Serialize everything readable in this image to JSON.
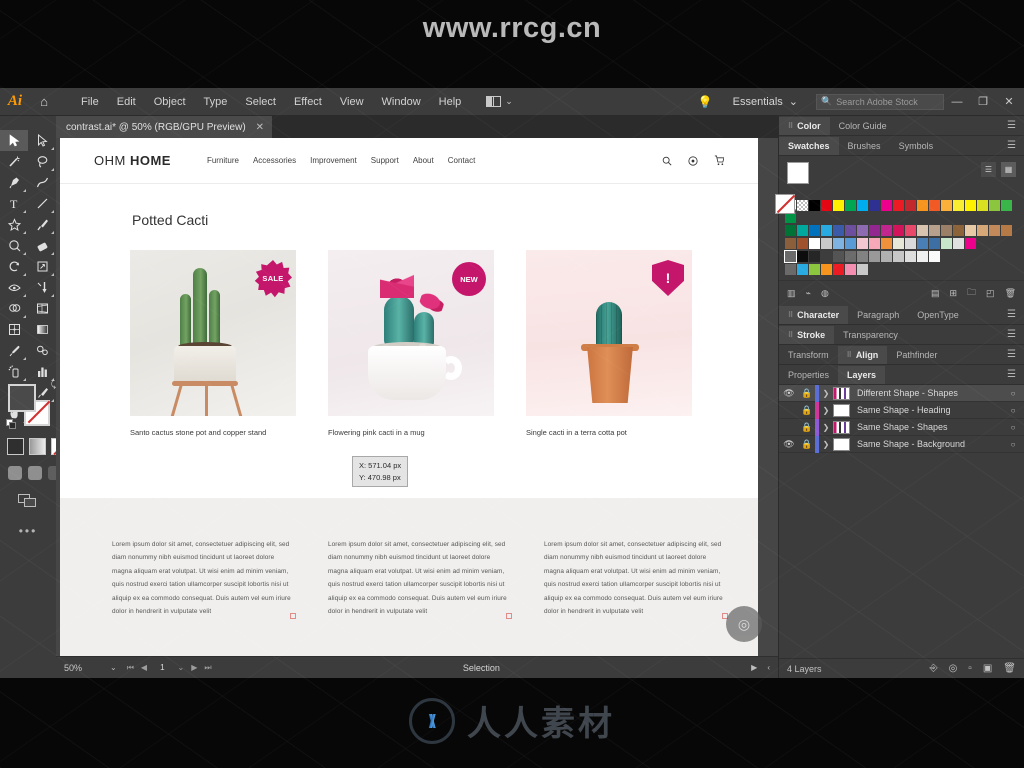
{
  "watermark": {
    "top": "www.rrcg.cn",
    "bottom": "人人素材",
    "logo_icon": "rrcg-logo-icon"
  },
  "app": {
    "logo": "Ai",
    "home_icon": "home-icon",
    "menu": [
      "File",
      "Edit",
      "Object",
      "Type",
      "Select",
      "Effect",
      "View",
      "Window",
      "Help"
    ],
    "arrange_icon": "arrange-documents-icon",
    "arrange_caret": "⌄",
    "bulb_icon": "lightbulb-icon",
    "workspace": "Essentials",
    "workspace_caret": "⌄",
    "search_icon": "search-icon",
    "search_placeholder": "Search Adobe Stock",
    "search_value": "",
    "window_buttons": {
      "minimize": "—",
      "restore": "❐",
      "close": "✕"
    },
    "collapse_icon": "«",
    "document_tab": {
      "title": "contrast.ai* @ 50% (RGB/GPU Preview)",
      "close": "✕"
    }
  },
  "toolbar": {
    "tools": [
      {
        "name": "selection-tool",
        "icon": "arrow-solid",
        "selected": true
      },
      {
        "name": "direct-selection-tool",
        "icon": "arrow-outline",
        "selected": false
      },
      {
        "name": "magic-wand-tool",
        "icon": "wand",
        "selected": false
      },
      {
        "name": "lasso-tool",
        "icon": "lasso",
        "selected": false
      },
      {
        "name": "pen-tool",
        "icon": "pen",
        "selected": false
      },
      {
        "name": "curvature-tool",
        "icon": "curvature",
        "selected": false
      },
      {
        "name": "type-tool",
        "icon": "T",
        "selected": false
      },
      {
        "name": "line-segment-tool",
        "icon": "line",
        "selected": false
      },
      {
        "name": "shape-tool",
        "icon": "star",
        "selected": false
      },
      {
        "name": "paintbrush-tool",
        "icon": "brush",
        "selected": false
      },
      {
        "name": "shaper-tool",
        "icon": "shaper",
        "selected": false
      },
      {
        "name": "eraser-tool",
        "icon": "eraser",
        "selected": false
      },
      {
        "name": "rotate-tool",
        "icon": "rotate",
        "selected": false
      },
      {
        "name": "scale-tool",
        "icon": "scale",
        "selected": false
      },
      {
        "name": "width-tool",
        "icon": "width",
        "selected": false
      },
      {
        "name": "free-transform-tool",
        "icon": "transform",
        "selected": false
      },
      {
        "name": "shape-builder-tool",
        "icon": "shape-builder",
        "selected": false
      },
      {
        "name": "perspective-grid-tool",
        "icon": "perspective",
        "selected": false
      },
      {
        "name": "mesh-tool",
        "icon": "mesh",
        "selected": false
      },
      {
        "name": "gradient-tool",
        "icon": "gradient",
        "selected": false
      },
      {
        "name": "eyedropper-tool",
        "icon": "eyedropper",
        "selected": false
      },
      {
        "name": "blend-tool",
        "icon": "blend",
        "selected": false
      },
      {
        "name": "symbol-sprayer-tool",
        "icon": "symbol-sprayer",
        "selected": false
      },
      {
        "name": "column-graph-tool",
        "icon": "bar-chart",
        "selected": false
      },
      {
        "name": "artboard-tool",
        "icon": "artboard",
        "selected": false
      },
      {
        "name": "slice-tool",
        "icon": "slice",
        "selected": false
      },
      {
        "name": "hand-tool",
        "icon": "hand",
        "selected": false
      },
      {
        "name": "zoom-tool",
        "icon": "magnifier",
        "selected": false
      }
    ],
    "fill_stroke": {
      "fill_icon": "fill-swatch",
      "stroke_icon": "stroke-swatch-none",
      "swap_icon": "swap-fill-stroke-icon",
      "default_icon": "default-fill-stroke-icon"
    },
    "color_modes": [
      "color-mode-icon",
      "gradient-mode-icon",
      "none-mode-icon"
    ],
    "draw_modes": [
      "draw-normal-icon",
      "draw-behind-icon",
      "draw-inside-icon"
    ],
    "screen_mode_icon": "change-screen-mode-icon",
    "more_icon": "edit-toolbar-icon"
  },
  "document": {
    "site": {
      "brand_light": "OHM ",
      "brand_bold": "HOME",
      "nav": [
        "Furniture",
        "Accessories",
        "Improvement",
        "Support",
        "About",
        "Contact"
      ],
      "icons": [
        "search-icon",
        "account-icon",
        "cart-icon"
      ],
      "section_title": "Potted Cacti",
      "cards": [
        {
          "caption": "Santo cactus stone pot and copper stand",
          "badge": "SALE",
          "badge_shape": "starburst"
        },
        {
          "caption": "Flowering pink cacti in a mug",
          "badge": "NEW",
          "badge_shape": "circle"
        },
        {
          "caption": "Single cacti in a terra cotta pot",
          "badge": "!",
          "badge_shape": "shield"
        }
      ],
      "lorem": "Lorem ipsum dolor sit amet, consectetuer adipiscing elit, sed diam nonummy nibh euismod tincidunt ut laoreet dolore magna aliquam erat volutpat. Ut wisi enim ad minim veniam, quis nostrud exerci tation ullamcorper suscipit lobortis nisi ut aliquip ex ea commodo consequat. Duis autem vel eum iriure dolor in hendrerit in vulputate velit",
      "lorem_columns": 3
    },
    "cursor_tooltip": {
      "x": "X: 571.04 px",
      "y": "Y: 470.98 px"
    }
  },
  "panels": {
    "group_color": {
      "tabs": [
        {
          "label": "Color",
          "active": true,
          "grip": true
        },
        {
          "label": "Color Guide",
          "active": false,
          "grip": false
        }
      ],
      "menu_icon": "panel-menu-icon"
    },
    "group_swatches": {
      "tabs": [
        {
          "label": "Swatches",
          "active": true,
          "grip": false
        },
        {
          "label": "Brushes",
          "active": false,
          "grip": false
        },
        {
          "label": "Symbols",
          "active": false,
          "grip": false
        }
      ],
      "menu_icon": "panel-menu-icon",
      "fill_icon": "swatch-fill-icon",
      "stroke_icon": "swatch-stroke-none-icon",
      "view_buttons": [
        "list-view-icon",
        "grid-view-icon"
      ],
      "active_view": "grid-view-icon",
      "footer_icons": [
        "swatch-libraries-icon",
        "show-swatch-kinds-icon",
        "color-group-icon",
        "swatch-options-icon",
        "new-color-group-icon",
        "new-swatch-icon",
        "delete-swatch-icon"
      ],
      "colors_row1": [
        "#ffffff",
        "#ffffff",
        "#000000",
        "#e30613",
        "#fff200",
        "#00a651",
        "#00aeef",
        "#2e3192",
        "#ec008c",
        "#ed1c24",
        "#c1272d",
        "#f7941e",
        "#f15a24",
        "#fbb03b",
        "#f9ed32",
        "#fff200",
        "#d9e021",
        "#8cc63f",
        "#39b54a",
        "#009245"
      ],
      "colors_row2": [
        "#007236",
        "#00a99d",
        "#0071bc",
        "#29abe2",
        "#3b5ba9",
        "#6b4e9e",
        "#8e6bb0",
        "#92278f",
        "#c1268f",
        "#d4145a",
        "#e8496a",
        "#d9c4b0",
        "#b8a18c",
        "#9c7f67",
        "#8c6239",
        "#e8c9a6",
        "#d6a878",
        "#c2895a",
        "#b57a45"
      ],
      "colors_row3": [
        "#8b5e3c",
        "#a0522d",
        "#ffffff",
        "#c9c9c9",
        "#7fb3e0",
        "#5a9bd5",
        "#f4c7d0",
        "#f7a8b8",
        "#f0913c",
        "#e8e8d8",
        "#dadada",
        "#4a7fb5",
        "#3d6fa5",
        "#c8e6c9",
        "#e0e0e0",
        "#ec008c"
      ],
      "colors_row4": [
        "#6a6a6a",
        "#0d0d0d",
        "#262626",
        "#3d3d3d",
        "#545454",
        "#6b6b6b",
        "#828282",
        "#999999",
        "#b0b0b0",
        "#c7c7c7",
        "#dedede",
        "#f0f0f0",
        "#fafafa"
      ],
      "colors_row5": [
        "#6a6a6a",
        "#29abe2",
        "#8cc63f",
        "#f7941e",
        "#ed1c24",
        "#f48fb1",
        "#c9c9c9"
      ]
    },
    "group_character": {
      "tabs": [
        {
          "label": "Character",
          "active": true,
          "grip": true
        },
        {
          "label": "Paragraph",
          "active": false,
          "grip": false
        },
        {
          "label": "OpenType",
          "active": false,
          "grip": false
        }
      ],
      "menu_icon": "panel-menu-icon"
    },
    "group_stroke": {
      "tabs": [
        {
          "label": "Stroke",
          "active": true,
          "grip": true
        },
        {
          "label": "Transparency",
          "active": false,
          "grip": false
        }
      ],
      "menu_icon": "panel-menu-icon"
    },
    "group_align": {
      "tabs": [
        {
          "label": "Transform",
          "active": false,
          "grip": false
        },
        {
          "label": "Align",
          "active": true,
          "grip": true
        },
        {
          "label": "Pathfinder",
          "active": false,
          "grip": false
        }
      ],
      "menu_icon": "panel-menu-icon"
    },
    "group_layers": {
      "tabs": [
        {
          "label": "Properties",
          "active": false,
          "grip": false
        },
        {
          "label": "Layers",
          "active": true,
          "grip": false
        }
      ],
      "menu_icon": "panel-menu-icon",
      "rows": [
        {
          "name": "Different Shape - Shapes",
          "visible": true,
          "locked": true,
          "color": "#5b6ed6",
          "selected": true
        },
        {
          "name": "Same Shape - Heading",
          "visible": false,
          "locked": true,
          "color": "#d0379a",
          "selected": false
        },
        {
          "name": "Same Shape - Shapes",
          "visible": false,
          "locked": true,
          "color": "#8e5bd6",
          "selected": false
        },
        {
          "name": "Same Shape - Background",
          "visible": true,
          "locked": true,
          "color": "#5b6ed6",
          "selected": false
        }
      ],
      "count_label": "4 Layers",
      "footer_icons": [
        "locate-object-icon",
        "make-clipping-mask-icon",
        "create-new-sublayer-icon",
        "create-new-layer-icon",
        "delete-layer-icon"
      ]
    }
  },
  "statusbar": {
    "zoom": "50%",
    "zoom_caret": "⌄",
    "first_icon": "⏮",
    "prev_icon": "◀",
    "page": "1",
    "next_icon": "▶",
    "last_icon": "⏭",
    "page_caret": "⌄",
    "status": "Selection",
    "arrow_right": "▶",
    "arrow_left": "‹",
    "fab_icon": "discover-icon"
  }
}
